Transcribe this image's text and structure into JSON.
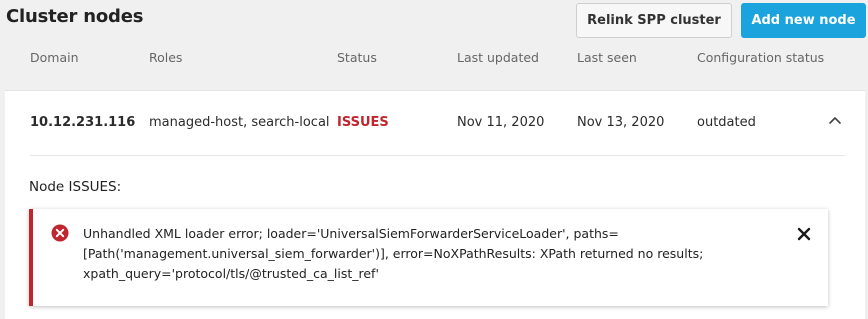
{
  "header": {
    "title": "Cluster nodes",
    "relink_label": "Relink SPP cluster",
    "add_node_label": "Add new node"
  },
  "colors": {
    "accent": "#1aa3dc",
    "issues": "#c0262d"
  },
  "table": {
    "columns": [
      "Domain",
      "Roles",
      "Status",
      "Last updated",
      "Last seen",
      "Configuration status"
    ],
    "rows": [
      {
        "domain": "10.12.231.116",
        "roles": "managed-host, search-local",
        "status": "ISSUES",
        "last_updated": "Nov 11, 2020",
        "last_seen": "Nov 13, 2020",
        "config_status": "outdated",
        "expanded": true
      }
    ]
  },
  "details": {
    "heading": "Node ISSUES:",
    "error": {
      "icon": "error-circle-icon",
      "lines": [
        "Unhandled XML loader error; loader='UniversalSiemForwarderServiceLoader', paths=",
        "[Path('management.universal_siem_forwarder')], error=NoXPathResults: XPath returned no results;",
        "xpath_query='protocol/tls/@trusted_ca_list_ref'"
      ]
    }
  }
}
